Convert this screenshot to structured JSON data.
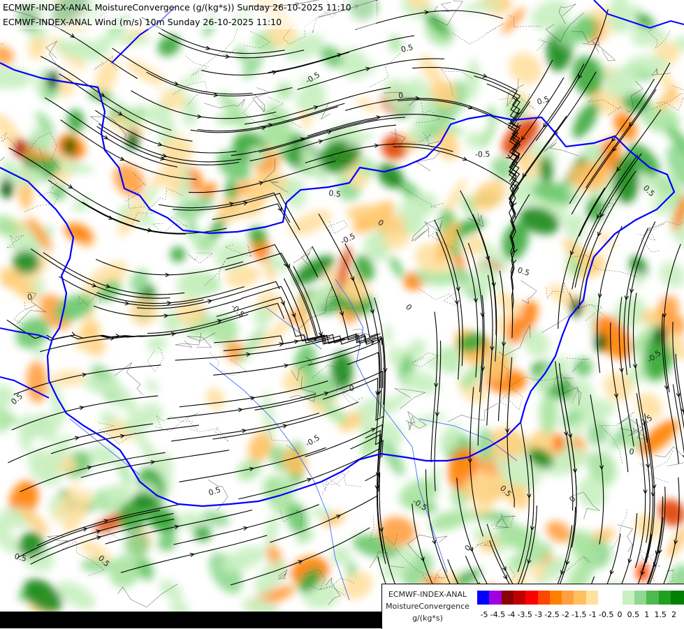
{
  "header": {
    "line1": "ECMWF-INDEX-ANAL MoistureConvergence (g/(kg*s)) Sunday 26-10-2025 11:10",
    "line2": "ECMWF-INDEX-ANAL Wind (m/s) 10m Sunday 26-10-2025 11:10"
  },
  "legend": {
    "model": "ECMWF-INDEX-ANAL",
    "parameter": "MoistureConvergence",
    "unit": "g/(kg*s)",
    "colors": [
      "#0000ff",
      "#a000e0",
      "#8b0000",
      "#c00000",
      "#ff0000",
      "#ff4500",
      "#ff7f00",
      "#ffa040",
      "#ffc060",
      "#ffe0a0",
      "#ffffff",
      "#ffffff",
      "#c8f0c0",
      "#90d890",
      "#50b850",
      "#20a020",
      "#008000"
    ],
    "ticks": [
      "-5",
      "-4.5",
      "-4",
      "-3.5",
      "-3",
      "-2.5",
      "-2",
      "-1.5",
      "-1",
      "-0.5",
      "0",
      "0.5",
      "1",
      "1.5",
      "2"
    ]
  },
  "map": {
    "contour_labels": [
      "0.5",
      "-0.5",
      "0",
      "0.5",
      "-0.5",
      "0.5",
      "0",
      "-0.5",
      "0.5",
      "0",
      "0.5",
      "-0.5",
      "0",
      "0.5",
      "0",
      "-0.5",
      "0.5",
      "0",
      "0.5",
      "-0.5",
      "0",
      "0.5",
      "0.5",
      "0",
      "-0.5",
      "0.5"
    ],
    "colors": {
      "border": "#0000ff",
      "river": "#4a6cff",
      "streamline": "#000000"
    }
  }
}
